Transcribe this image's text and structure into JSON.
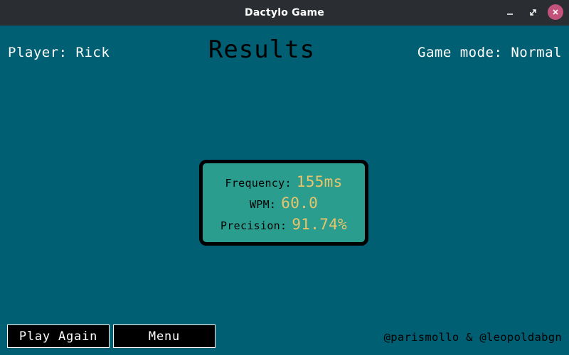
{
  "window": {
    "title": "Dactylo Game",
    "controls": [
      "minimize-icon",
      "maximize-icon",
      "close-icon"
    ],
    "close_color": "#c3537a"
  },
  "header": {
    "player": "Player: Rick",
    "title": "Results",
    "mode": "Game mode: Normal"
  },
  "stats": {
    "frequency": {
      "label": "Frequency:",
      "value": "155ms"
    },
    "wpm": {
      "label": "WPM:",
      "value": "60.0"
    },
    "precision": {
      "label": "Precision:",
      "value": "91.74%"
    }
  },
  "buttons": {
    "play_again": "Play Again",
    "menu": "Menu"
  },
  "footer": {
    "credits": "@parismollo & @leopoldabgn"
  },
  "colors": {
    "background": "#005f73",
    "stats_box": "#2a9d8f",
    "stat_value": "#e9c46a",
    "titlebar": "#2a2e32"
  }
}
